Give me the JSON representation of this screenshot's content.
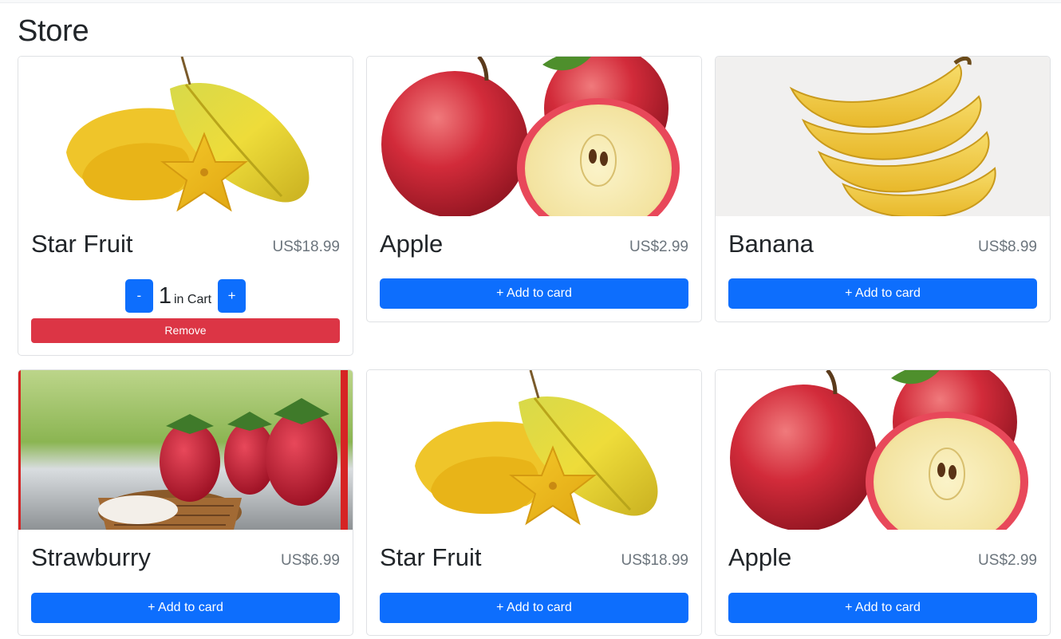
{
  "store": {
    "title": "Store"
  },
  "cards": [
    {
      "name": "Star Fruit",
      "price": "US$18.99",
      "image": "star-fruit-image",
      "in_cart": true,
      "quantity": "1",
      "in_cart_label": "in Cart",
      "minus_label": "-",
      "plus_label": "+",
      "remove_label": "Remove"
    },
    {
      "name": "Apple",
      "price": "US$2.99",
      "image": "apple-image",
      "in_cart": false,
      "add_label": "+ Add to card"
    },
    {
      "name": "Banana",
      "price": "US$8.99",
      "image": "banana-image",
      "in_cart": false,
      "add_label": "+ Add to card"
    },
    {
      "name": "Strawburry",
      "price": "US$6.99",
      "image": "strawberry-image",
      "in_cart": false,
      "add_label": "+ Add to card"
    },
    {
      "name": "Star Fruit",
      "price": "US$18.99",
      "image": "star-fruit-image",
      "in_cart": false,
      "add_label": "+ Add to card"
    },
    {
      "name": "Apple",
      "price": "US$2.99",
      "image": "apple-image",
      "in_cart": false,
      "add_label": "+ Add to card"
    }
  ],
  "colors": {
    "primary": "#0d6efd",
    "danger": "#dc3545",
    "price_text": "#6c757d",
    "card_border": "#dfe1e4"
  }
}
